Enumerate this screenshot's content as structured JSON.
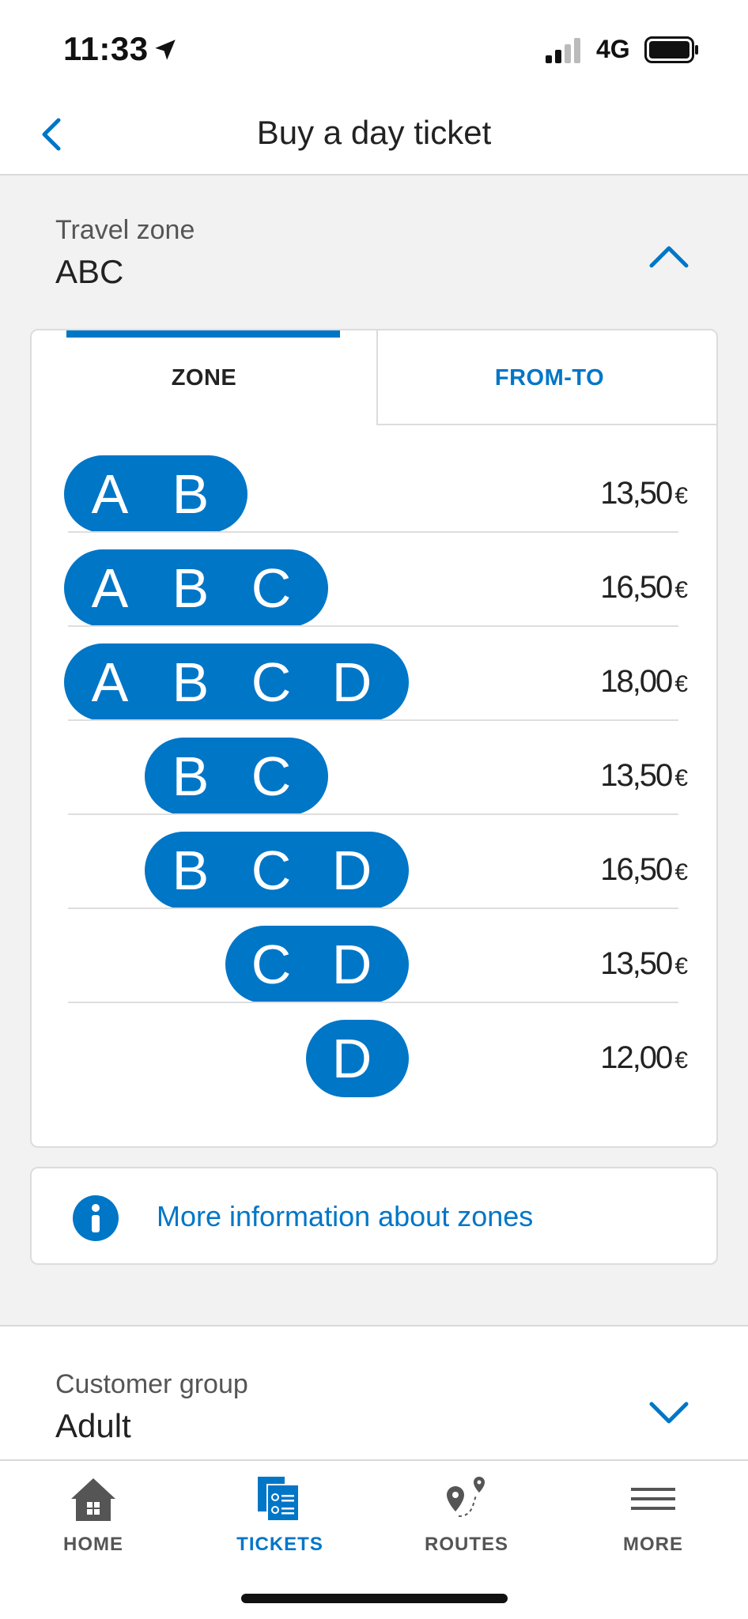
{
  "status": {
    "time": "11:33",
    "network": "4G"
  },
  "nav": {
    "title": "Buy a day ticket"
  },
  "travel_zone": {
    "label": "Travel zone",
    "value": "ABC"
  },
  "tabs": {
    "zone": "ZONE",
    "from_to": "FROM-TO"
  },
  "zones": [
    {
      "letters": [
        "A",
        "B",
        null,
        null
      ],
      "price": "13,50",
      "currency": "€"
    },
    {
      "letters": [
        "A",
        "B",
        "C",
        null
      ],
      "price": "16,50",
      "currency": "€"
    },
    {
      "letters": [
        "A",
        "B",
        "C",
        "D"
      ],
      "price": "18,00",
      "currency": "€"
    },
    {
      "letters": [
        null,
        "B",
        "C",
        null
      ],
      "price": "13,50",
      "currency": "€"
    },
    {
      "letters": [
        null,
        "B",
        "C",
        "D"
      ],
      "price": "16,50",
      "currency": "€"
    },
    {
      "letters": [
        null,
        null,
        "C",
        "D"
      ],
      "price": "13,50",
      "currency": "€"
    },
    {
      "letters": [
        null,
        null,
        null,
        "D"
      ],
      "price": "12,00",
      "currency": "€"
    }
  ],
  "info": {
    "text": "More information about zones"
  },
  "customer_group": {
    "label": "Customer group",
    "value": "Adult"
  },
  "tabbar": [
    {
      "label": "HOME",
      "icon": "home-icon",
      "active": false
    },
    {
      "label": "TICKETS",
      "icon": "tickets-icon",
      "active": true
    },
    {
      "label": "ROUTES",
      "icon": "routes-icon",
      "active": false
    },
    {
      "label": "MORE",
      "icon": "menu-icon",
      "active": false
    }
  ],
  "colors": {
    "accent": "#0076c7",
    "background": "#f2f2f2"
  }
}
